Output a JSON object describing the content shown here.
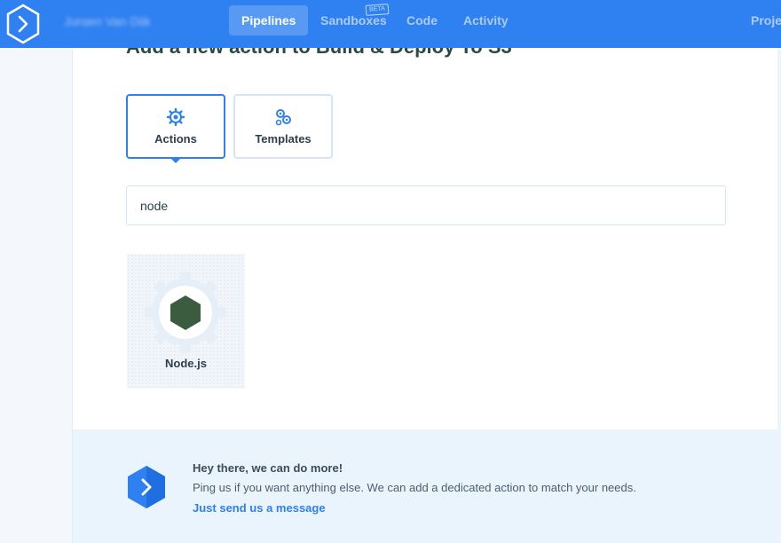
{
  "nav": {
    "org_name": "Jurgen Van Dijk",
    "items": [
      {
        "label": "Pipelines",
        "active": true
      },
      {
        "label": "Sandboxes",
        "active": false
      },
      {
        "label": "Code",
        "active": false
      },
      {
        "label": "Activity",
        "active": false
      },
      {
        "label": "Proje",
        "active": false
      }
    ],
    "beta_badge": "BETA"
  },
  "page": {
    "title": "Add a new action to Build & Deploy To S3"
  },
  "tabs": [
    {
      "label": "Actions",
      "active": true,
      "icon": "gear-icon"
    },
    {
      "label": "Templates",
      "active": false,
      "icon": "gears-icon"
    }
  ],
  "search": {
    "value": "node",
    "placeholder": ""
  },
  "results": [
    {
      "label": "Node.js",
      "icon": "nodejs-icon"
    }
  ],
  "footer": {
    "heading": "Hey there, we can do more!",
    "text": "Ping us if you want anything else. We can add a dedicated action to match your needs.",
    "link": "Just send us a message"
  },
  "colors": {
    "brand": "#2f80f0",
    "node_green": "#3c5c3f"
  }
}
